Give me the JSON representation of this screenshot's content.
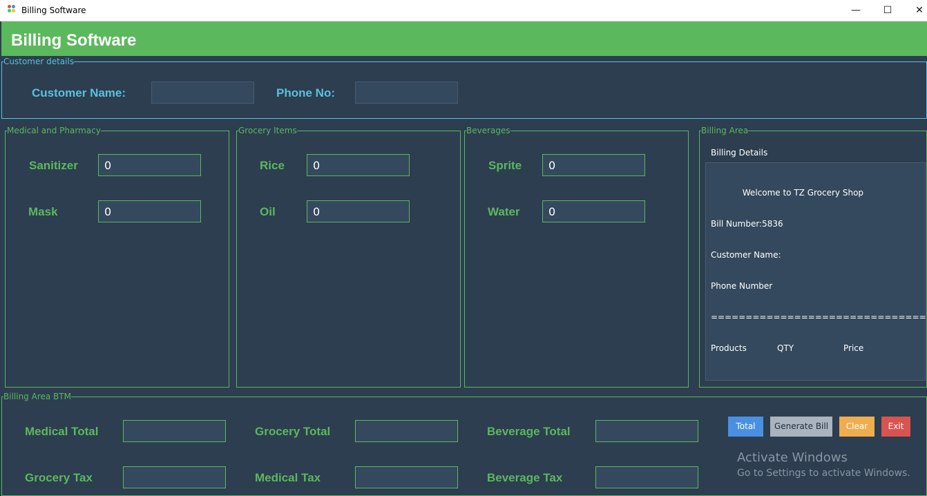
{
  "window": {
    "title": "Billing Software",
    "minimize_glyph": "—",
    "maximize_glyph": "☐",
    "close_glyph": "✕"
  },
  "header": {
    "title": "Billing Software"
  },
  "customer_details": {
    "legend": "Customer details",
    "name_label": "Customer Name:",
    "name_value": "",
    "phone_label": "Phone No:",
    "phone_value": ""
  },
  "medical": {
    "legend": "Medical and Pharmacy",
    "items": [
      {
        "label": "Sanitizer",
        "value": "0"
      },
      {
        "label": "Mask",
        "value": "0"
      }
    ]
  },
  "grocery": {
    "legend": "Grocery Items",
    "items": [
      {
        "label": "Rice",
        "value": "0"
      },
      {
        "label": "Oil",
        "value": "0"
      }
    ]
  },
  "beverages": {
    "legend": "Beverages",
    "items": [
      {
        "label": "Sprite",
        "value": "0"
      },
      {
        "label": "Water",
        "value": "0"
      }
    ]
  },
  "billing_area": {
    "legend": "Billing Area",
    "title": "Billing Details",
    "lines": {
      "welcome": "            Welcome to TZ Grocery Shop",
      "bill_number": "Bill Number:5836",
      "customer_name": "Customer Name:",
      "phone_number": "Phone Number",
      "separator": "==============================="
    },
    "columns": {
      "products": "Products",
      "qty": "QTY",
      "price": "Price"
    }
  },
  "bottom": {
    "legend": "Billing Area BTM",
    "medical_total_label": "Medical Total",
    "grocery_total_label": "Grocery Total",
    "beverage_total_label": "Beverage Total",
    "grocery_tax_label": "Grocery Tax",
    "medical_tax_label": "Medical Tax",
    "beverage_tax_label": "Beverage Tax",
    "buttons": {
      "total": "Total",
      "generate": "Generate Bill",
      "clear": "Clear",
      "exit": "Exit"
    }
  },
  "watermark": {
    "line1": "Activate Windows",
    "line2": "Go to Settings to activate Windows."
  },
  "colors": {
    "background": "#2c3e50",
    "header": "#5cb85c",
    "accent_green": "#5cb85c",
    "accent_blue": "#5bc0de",
    "button_total": "#4a90e2",
    "button_generate": "#aab4be",
    "button_clear": "#f0ad4e",
    "button_exit": "#d9534f"
  }
}
